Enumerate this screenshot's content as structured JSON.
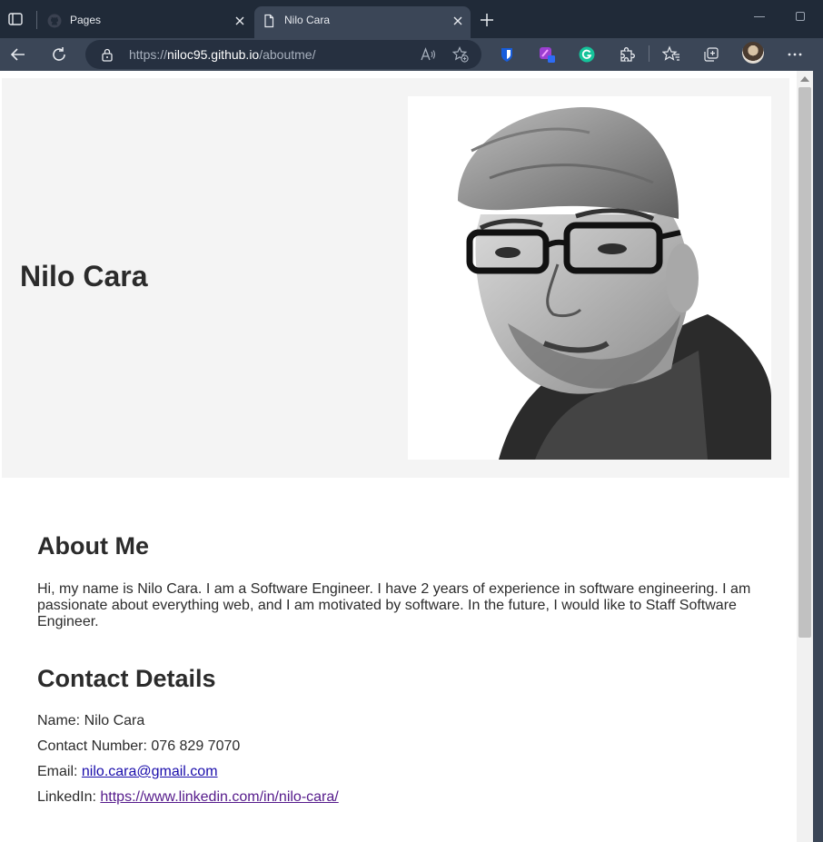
{
  "browser": {
    "tabs": [
      {
        "title": "Pages",
        "active": false
      },
      {
        "title": "Nilo Cara",
        "active": true
      }
    ],
    "address": {
      "scheme": "https://",
      "host": "niloc95.github.io",
      "path": "/aboutme/"
    },
    "icons": {
      "tab_actions": "tab-actions-icon",
      "back": "back-arrow-icon",
      "refresh": "refresh-icon",
      "lock": "lock-icon",
      "read_aloud": "read-aloud-icon",
      "add_favorite": "add-favorite-icon",
      "extensions": [
        "bitwarden-icon",
        "paint-extension-icon",
        "grammarly-icon",
        "puzzle-icon"
      ],
      "favorites": "favorites-icon",
      "collections": "collections-icon",
      "more": "more-icon"
    }
  },
  "page": {
    "hero": {
      "name": "Nilo Cara",
      "photo_alt": "Black and white portrait of Nilo Cara wearing a cap and glasses"
    },
    "about": {
      "heading": "About Me",
      "text": "Hi, my name is Nilo Cara. I am a Software Engineer. I have 2 years of experience in software engineering. I am passionate about everything web, and I am motivated by software. In the future, I would like to Staff Software Engineer."
    },
    "contact": {
      "heading": "Contact Details",
      "name_label": "Name:",
      "name_value": "Nilo Cara",
      "number_label": "Contact Number:",
      "number_value": "076 829 7070",
      "email_label": "Email:",
      "email_value": "nilo.cara@gmail.com",
      "linkedin_label": "LinkedIn:",
      "linkedin_value": "https://www.linkedin.com/in/nilo-cara/"
    }
  },
  "colors": {
    "tabstrip_bg": "#202a38",
    "toolbar_bg": "#3b4657",
    "hero_bg": "#f4f4f4",
    "text": "#2b2b2b",
    "link": "#1a0dab",
    "link_visited": "#551a8b"
  }
}
